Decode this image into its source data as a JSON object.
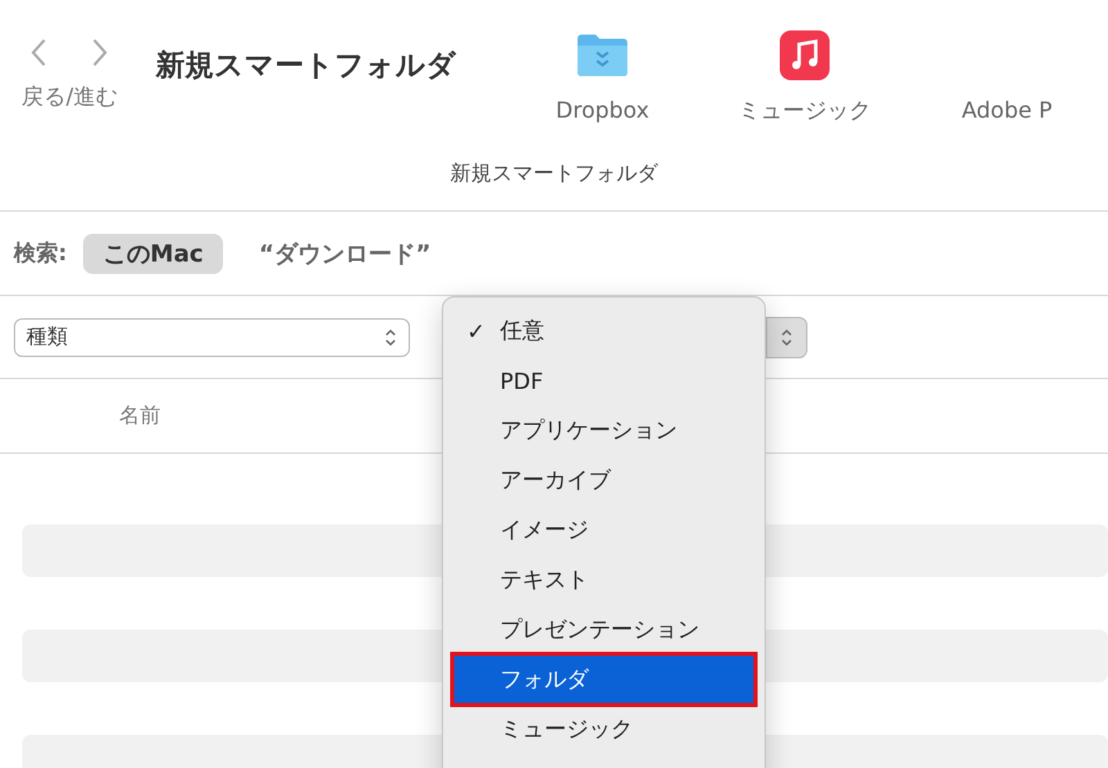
{
  "toolbar": {
    "nav_label": "戻る/進む",
    "title": "新規スマートフォルダ",
    "items": [
      {
        "kind": "folder",
        "label": "Dropbox"
      },
      {
        "kind": "music",
        "label": "ミュージック"
      },
      {
        "kind": "none",
        "label": "Adobe P"
      }
    ]
  },
  "window": {
    "title": "新規スマートフォルダ"
  },
  "search": {
    "label": "検索:",
    "scopes": [
      {
        "label": "このMac",
        "selected": true
      },
      {
        "label": "“ダウンロード”",
        "selected": false
      }
    ]
  },
  "criteria": {
    "attribute": "種類"
  },
  "table": {
    "columns": [
      "名前"
    ],
    "stripes": [
      false,
      true,
      false,
      true,
      false,
      true
    ]
  },
  "menu": {
    "check_mark": "✓",
    "items": [
      {
        "label": "任意",
        "checked": true,
        "selected": false
      },
      {
        "label": "PDF",
        "checked": false,
        "selected": false
      },
      {
        "label": "アプリケーション",
        "checked": false,
        "selected": false
      },
      {
        "label": "アーカイブ",
        "checked": false,
        "selected": false
      },
      {
        "label": "イメージ",
        "checked": false,
        "selected": false
      },
      {
        "label": "テキスト",
        "checked": false,
        "selected": false
      },
      {
        "label": "プレゼンテーション",
        "checked": false,
        "selected": false
      },
      {
        "label": "フォルダ",
        "checked": false,
        "selected": true
      },
      {
        "label": "ミュージック",
        "checked": false,
        "selected": false
      }
    ]
  }
}
